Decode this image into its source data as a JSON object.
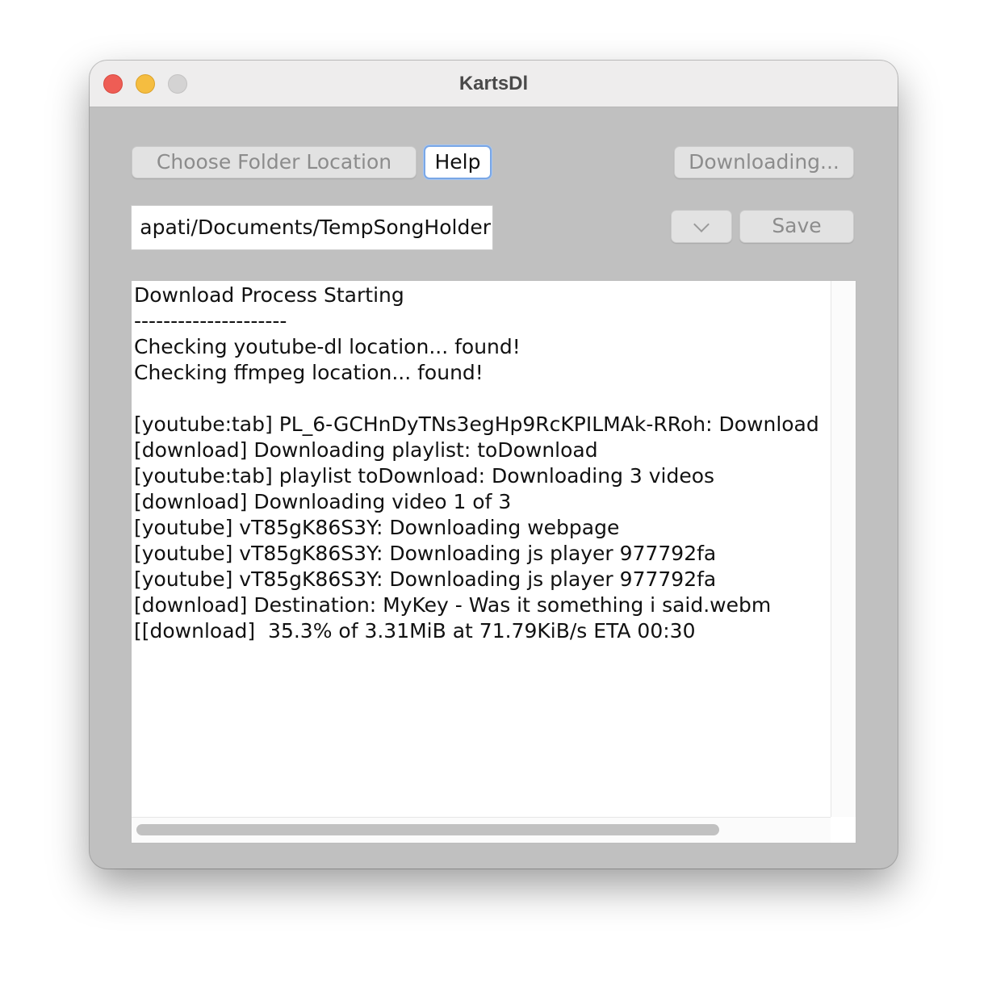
{
  "window": {
    "title": "KartsDl"
  },
  "toolbar": {
    "choose_folder_label": "Choose Folder Location",
    "help_label": "Help",
    "downloading_label": "Downloading...",
    "save_label": "Save"
  },
  "folder": {
    "path_visible": "apati/Documents/TempSongHolder"
  },
  "icons": {
    "dropdown": "chevron-down-icon"
  },
  "log": {
    "lines": [
      "Download Process Starting",
      "---------------------",
      "Checking youtube-dl location... found!",
      "Checking ffmpeg location... found!",
      "",
      "[youtube:tab] PL_6-GCHnDyTNs3egHp9RcKPILMAk-RRoh: Download",
      "[download] Downloading playlist: toDownload",
      "[youtube:tab] playlist toDownload: Downloading 3 videos",
      "[download] Downloading video 1 of 3",
      "[youtube] vT85gK86S3Y: Downloading webpage",
      "[youtube] vT85gK86S3Y: Downloading js player 977792fa",
      "[youtube] vT85gK86S3Y: Downloading js player 977792fa",
      "[download] Destination: MyKey - Was it something i said.webm",
      "[[download]  35.3% of 3.31MiB at 71.79KiB/s ETA 00:30"
    ]
  },
  "colors": {
    "window_bg": "#c0c0c0",
    "titlebar_bg": "#eeeded",
    "close_light": "#ee5d55",
    "minimize_light": "#f5bd40",
    "zoom_light": "#d4d3d3",
    "focus_ring": "#7aa7e6"
  }
}
